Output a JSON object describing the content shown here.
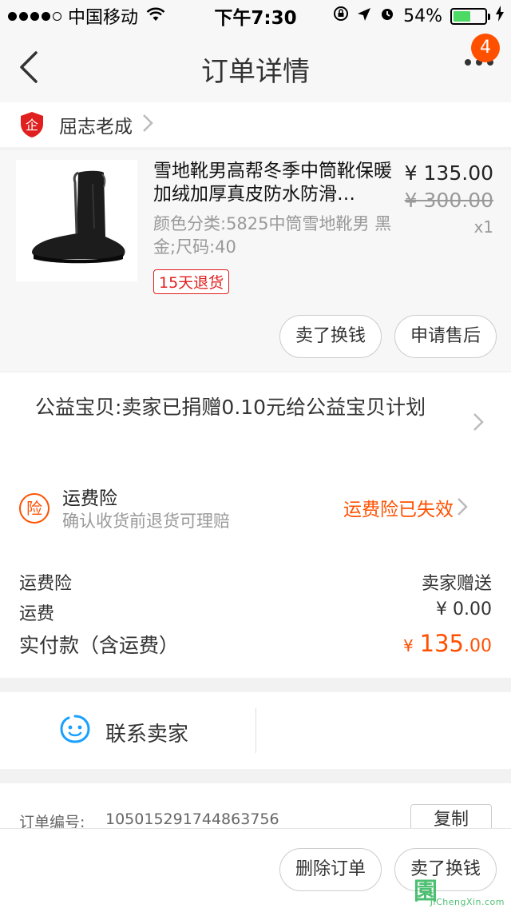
{
  "status_bar": {
    "carrier": "中国移动",
    "time": "下午7:30",
    "battery": "54%",
    "battery_level": 0.54
  },
  "navbar": {
    "title": "订单详情",
    "badge": "4",
    "back_icon": "chevron-left-icon",
    "more_icon": "more-dots-icon"
  },
  "shop": {
    "name": "屈志老成",
    "logo_icon": "enterprise-shield-icon"
  },
  "product": {
    "title": "雪地靴男高帮冬季中筒靴保暖加绒加厚真皮防水防滑…",
    "sku": "颜色分类:5825中筒雪地靴男 黑金;尺码:40",
    "return_tag": "15天退货",
    "price": "¥ 135.00",
    "original_price": "¥ 300.00",
    "quantity": "x1",
    "buttons": {
      "sell": "卖了换钱",
      "after_sale": "申请售后"
    }
  },
  "charity": {
    "text": "公益宝贝:卖家已捐赠0.10元给公益宝贝计划"
  },
  "insurance": {
    "icon_label": "险",
    "title": "运费险",
    "subtitle": "确认收货前退货可理赔",
    "status": "运费险已失效"
  },
  "fees": {
    "shipping_insurance_label": "运费险",
    "shipping_insurance_value": "卖家赠送",
    "shipping_label": "运费",
    "shipping_value": "¥ 0.00",
    "total_label": "实付款（含运费）",
    "total_yen": "¥",
    "total_int": "135",
    "total_dec": ".00"
  },
  "contact": {
    "label": "联系卖家"
  },
  "order": {
    "number_label": "订单编号:",
    "number": "105015291744863756",
    "copy_label": "复制"
  },
  "bottom_bar": {
    "delete": "删除订单",
    "sell": "卖了换钱"
  },
  "watermark": {
    "glyph": "園",
    "url": "JiChengXin.com"
  },
  "colors": {
    "accent": "#ff5000",
    "return_tag": "#e0201f",
    "battery": "#4cd964",
    "contact_icon": "#1aa0ff",
    "shop_logo": "#e0201f"
  }
}
